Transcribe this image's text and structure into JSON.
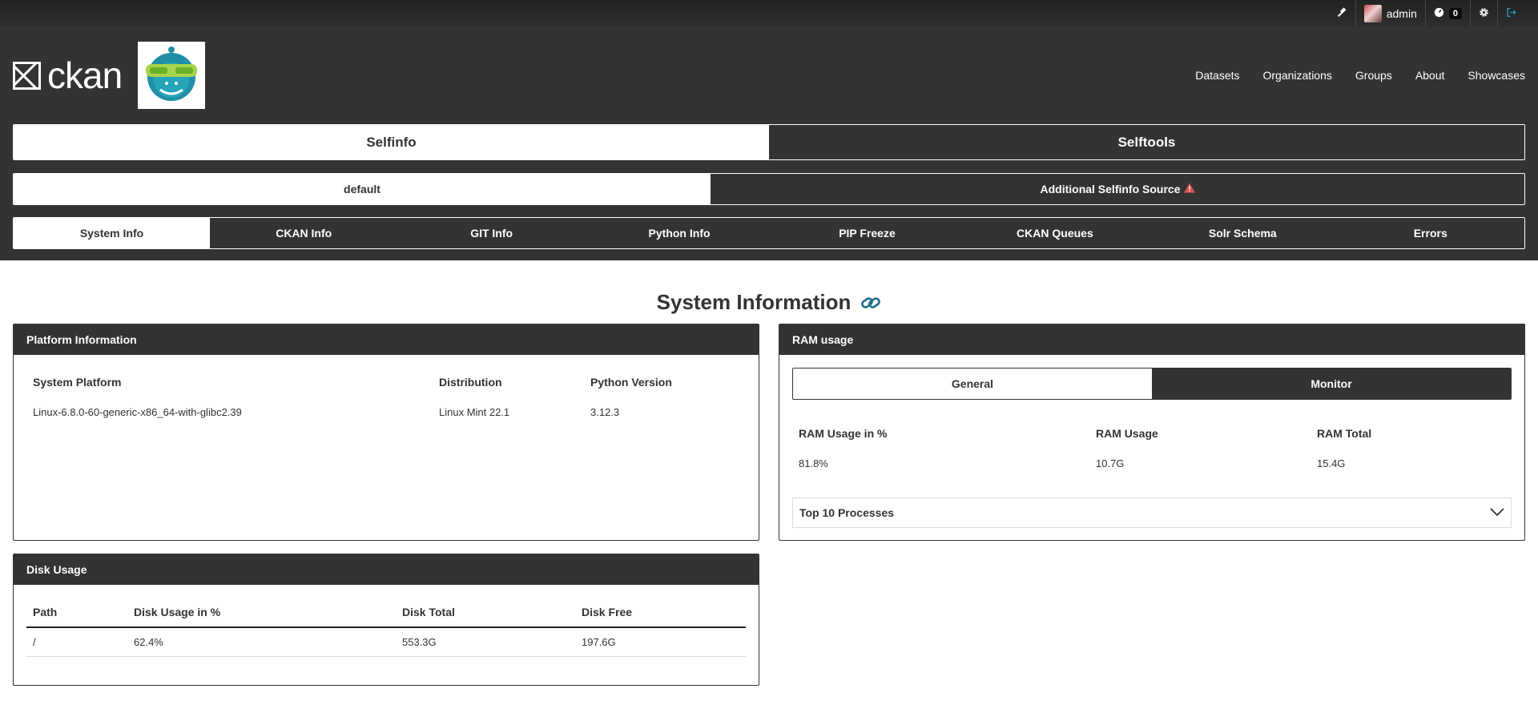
{
  "account": {
    "username": "admin",
    "notification_count": "0"
  },
  "site": {
    "brand": "ckan"
  },
  "nav": {
    "items": [
      "Datasets",
      "Organizations",
      "Groups",
      "About",
      "Showcases"
    ]
  },
  "main_tabs": {
    "selfinfo": "Selfinfo",
    "selftools": "Selftools"
  },
  "source_tabs": {
    "default": "default",
    "additional": "Additional Selfinfo Source"
  },
  "info_tabs": [
    "System Info",
    "CKAN Info",
    "GIT Info",
    "Python Info",
    "PIP Freeze",
    "CKAN Queues",
    "Solr Schema",
    "Errors"
  ],
  "page": {
    "title": "System Information"
  },
  "platform": {
    "heading": "Platform Information",
    "headers": [
      "System Platform",
      "Distribution",
      "Python Version"
    ],
    "values": [
      "Linux-6.8.0-60-generic-x86_64-with-glibc2.39",
      "Linux Mint 22.1",
      "3.12.3"
    ]
  },
  "ram": {
    "heading": "RAM usage",
    "tabs": [
      "General",
      "Monitor"
    ],
    "headers": [
      "RAM Usage in %",
      "RAM Usage",
      "RAM Total"
    ],
    "values": [
      "81.8%",
      "10.7G",
      "15.4G"
    ],
    "top_processes": "Top 10 Processes"
  },
  "disk": {
    "heading": "Disk Usage",
    "headers": [
      "Path",
      "Disk Usage in %",
      "Disk Total",
      "Disk Free"
    ],
    "rows": [
      [
        "/",
        "62.4%",
        "553.3G",
        "197.6G"
      ]
    ]
  },
  "colors": {
    "header_bg": "#333333",
    "warning": "#d9534f",
    "link_icon": "#1d6e8a"
  }
}
